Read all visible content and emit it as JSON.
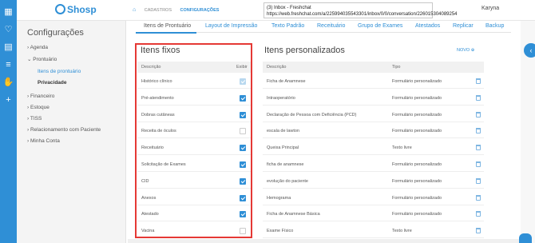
{
  "app": {
    "logo_text": "Shosp",
    "brand_color": "#2f8fd6",
    "alert_color": "#e53935"
  },
  "rail": {
    "icons": [
      "calendar-icon",
      "heart-icon",
      "money-icon",
      "database-icon",
      "handshake-icon",
      "plus-icon"
    ]
  },
  "breadcrumb": {
    "home_icon": "home-icon",
    "items": [
      "CADASTROS",
      "CONFIGURAÇÕES"
    ]
  },
  "tooltip": {
    "line1": "(3) Inbox - Freshchat",
    "line2": "https://web.freshchat.com/a/225994035543301/inbox/0/0/conversation/226015304089254"
  },
  "user": {
    "name": "Karyna"
  },
  "sidebar": {
    "title": "Configurações",
    "items": [
      "Agenda",
      "Prontuário",
      "Financeiro",
      "Estoque",
      "TISS",
      "Relacionamento com Paciente",
      "Minha Conta"
    ],
    "subitems": [
      "Itens de prontuário",
      "Privacidade"
    ]
  },
  "tabs": [
    "Itens de Prontuário",
    "Layout de Impressão",
    "Texto Padrão",
    "Receituário",
    "Grupo de Exames",
    "Atestados",
    "Replicar",
    "Backup"
  ],
  "fixed": {
    "title": "Itens fixos",
    "col_desc": "Descrição",
    "col_show": "Exibir",
    "rows": [
      {
        "label": "Histórico clínico",
        "state": "disabled"
      },
      {
        "label": "Pré-atendimento",
        "state": "checked"
      },
      {
        "label": "Dobras cutâneas",
        "state": "checked"
      },
      {
        "label": "Receita de óculos",
        "state": "unchecked"
      },
      {
        "label": "Receituário",
        "state": "checked"
      },
      {
        "label": "Solicitação de Exames",
        "state": "checked"
      },
      {
        "label": "CID",
        "state": "checked"
      },
      {
        "label": "Anexos",
        "state": "checked"
      },
      {
        "label": "Atestado",
        "state": "checked"
      },
      {
        "label": "Vacina",
        "state": "unchecked"
      }
    ]
  },
  "custom": {
    "title": "Itens personalizados",
    "new_button": "NOVO ⊕",
    "col_desc": "Descrição",
    "col_type": "Tipo",
    "rows": [
      {
        "desc": "Ficha de Anamnese",
        "type": "Formulário personalizado"
      },
      {
        "desc": "Intraoperatório",
        "type": "Formulário personalizado"
      },
      {
        "desc": "Declaração de Pessoa com Deficiência (PCD)",
        "type": "Formulário personalizado"
      },
      {
        "desc": "escala de lawton",
        "type": "Formulário personalizado"
      },
      {
        "desc": "Queixa Principal",
        "type": "Texto livre"
      },
      {
        "desc": "ficha de anamnese",
        "type": "Formulário personalizado"
      },
      {
        "desc": "evolução do paciente",
        "type": "Formulário personalizado"
      },
      {
        "desc": "Hemograma",
        "type": "Formulário personalizado"
      },
      {
        "desc": "Ficha de Anamnese Básica",
        "type": "Formulário personalizado"
      },
      {
        "desc": "Exame Físico",
        "type": "Texto livre"
      }
    ]
  }
}
